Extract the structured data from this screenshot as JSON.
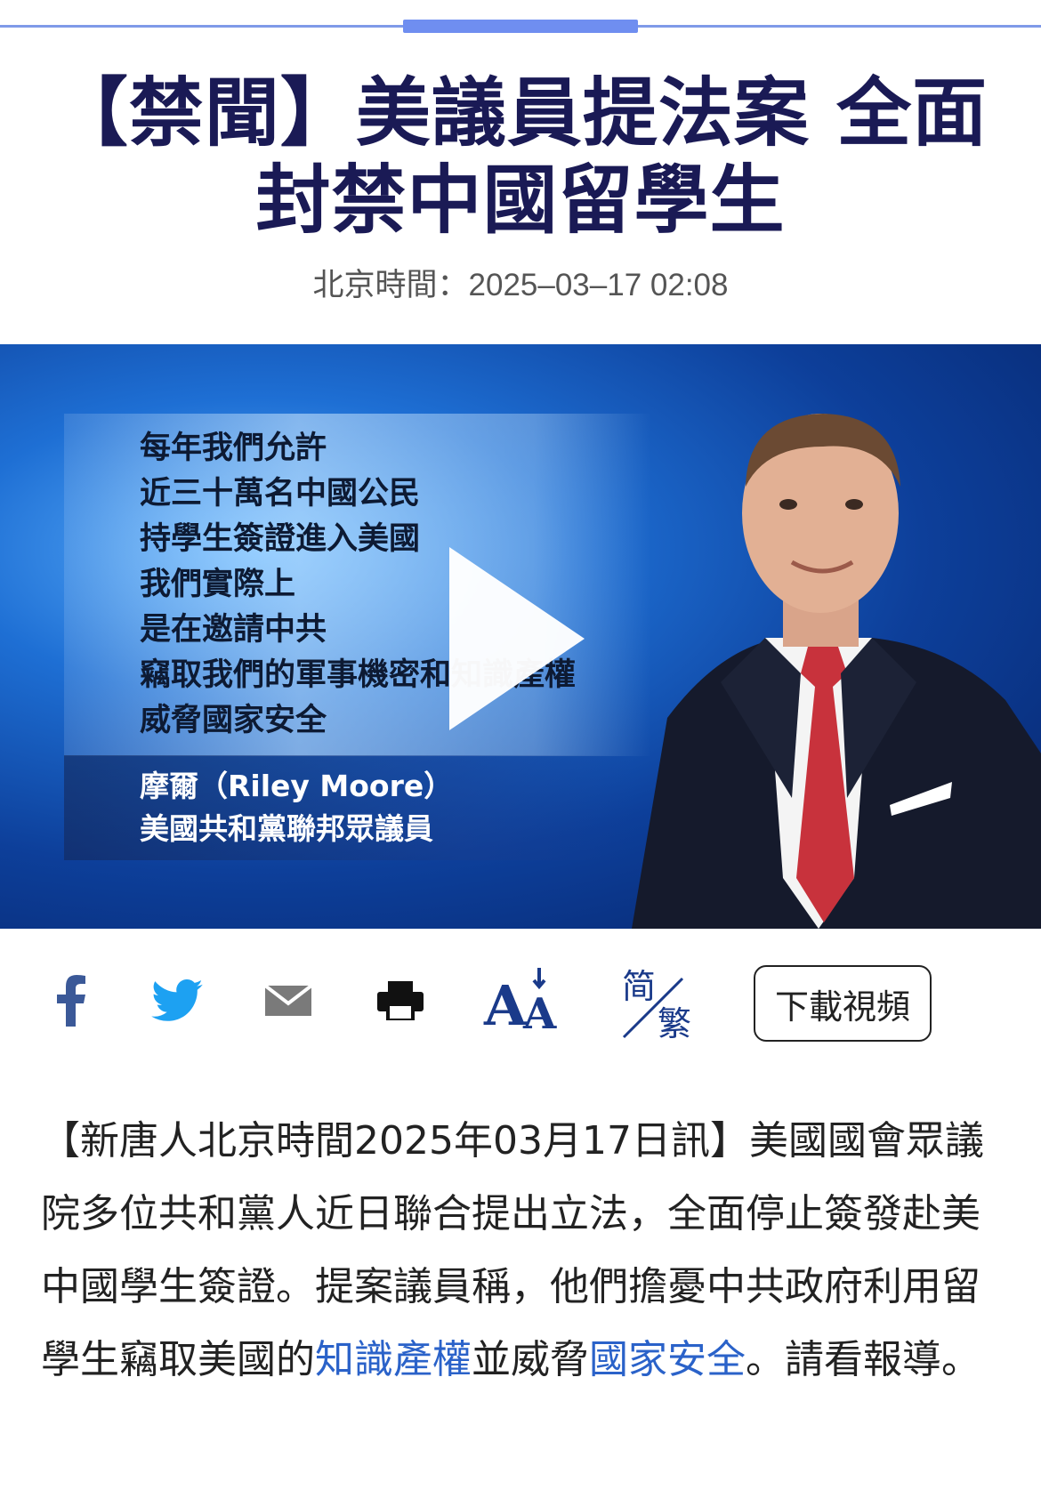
{
  "headline": "【禁聞】美議員提法案 全面封禁中國留學生",
  "timestamp": "北京時間：2025–03–17 02:08",
  "video": {
    "quote_lines": [
      "每年我們允許",
      "近三十萬名中國公民",
      "持學生簽證進入美國",
      "我們實際上",
      "是在邀請中共",
      "竊取我們的軍事機密和知識產權",
      "威脅國家安全"
    ],
    "speaker_name": "摩爾（Riley Moore）",
    "speaker_title": "美國共和黨聯邦眾議員"
  },
  "toolbar": {
    "icons": [
      "facebook-icon",
      "twitter-icon",
      "email-icon",
      "print-icon",
      "font-size-icon",
      "simplified-traditional-icon"
    ],
    "font_size_label": "AA",
    "simplified_label": "简",
    "traditional_label": "繁",
    "download_label": "下載視頻"
  },
  "article": {
    "text_1": "【新唐人北京時間2025年03月17日訊】美國國會眾議院多位共和黨人近日聯合提出立法，全面停止簽發赴美中國學生簽證。提案議員稱，他們擔憂中共政府利用留學生竊取美國的",
    "link_1": "知識產權",
    "text_2": "並威脅",
    "link_2": "國家安全",
    "text_3": "。請看報導。"
  },
  "colors": {
    "headline": "#1a1a55",
    "link": "#2a62c9",
    "accent_bar": "#6f8ef0",
    "facebook": "#3b5998",
    "twitter": "#1da1f2"
  }
}
